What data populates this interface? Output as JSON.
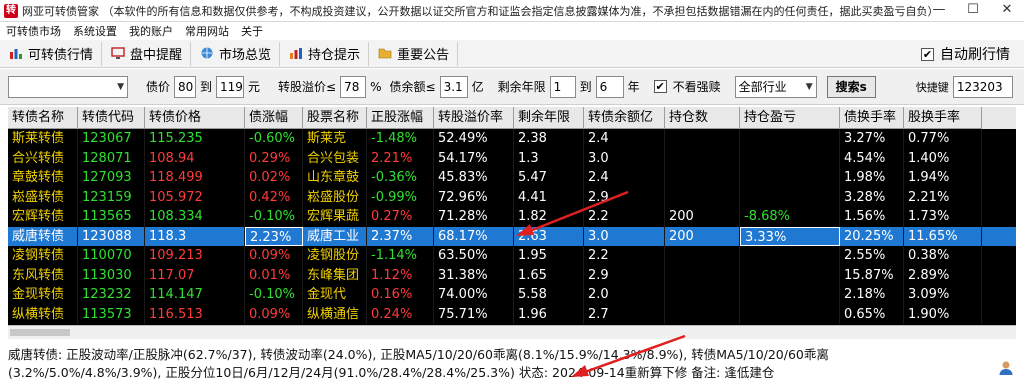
{
  "window": {
    "title": "网亚可转债管家 （本软件的所有信息和数据仅供参考，不构成投资建议，公开数据以证交所官方和证监会指定信息披露媒体为准，不承担包括数据错漏在内的任何责任，据此买卖盈亏自负）",
    "icon_glyph": "转",
    "minimize": "—",
    "maximize": "☐",
    "close": "✕"
  },
  "menu": [
    "可转债市场",
    "系统设置",
    "我的账户",
    "常用网站",
    "关于"
  ],
  "tabs": [
    {
      "label": "可转债行情",
      "icon": "chart-bars-icon"
    },
    {
      "label": "盘中提醒",
      "icon": "monitor-icon"
    },
    {
      "label": "市场总览",
      "icon": "globe-icon"
    },
    {
      "label": "持仓提示",
      "icon": "bar-chart-icon"
    },
    {
      "label": "重要公告",
      "icon": "folder-icon"
    }
  ],
  "auto_refresh": {
    "label": "自动刷行情",
    "checked": true
  },
  "filters": {
    "category_value": "",
    "bond_price_label": "债价",
    "bond_price_min": "80",
    "to1": "到",
    "bond_price_max": "119",
    "yuan": "元",
    "premium_label": "转股溢价≤",
    "premium_value": "78",
    "pct": "%",
    "balance_label": "债余额≤",
    "balance_value": "3.1",
    "yi": "亿",
    "years_label": "剩余年限",
    "years_min": "1",
    "to2": "到",
    "years_max": "6",
    "nian": "年",
    "hide_forced_label": "不看强赎",
    "hide_forced_checked": true,
    "industry_value": "全部行业",
    "search_label": "搜索s",
    "hotkey_label": "快捷键",
    "hotkey_value": "123203"
  },
  "table": {
    "columns": [
      "转债名称",
      "转债代码",
      "转债价格",
      "债涨幅",
      "股票名称",
      "正股涨幅",
      "转股溢价率",
      "剩余年限",
      "转债余额亿",
      "持仓数",
      "持仓盈亏",
      "债换手率",
      "股换手率"
    ],
    "rows": [
      [
        "斯莱转债",
        "123067",
        "115.235",
        "-0.60%",
        "斯莱克",
        "-1.48%",
        "52.49%",
        "2.38",
        "2.4",
        "",
        "",
        "3.27%",
        "0.77%"
      ],
      [
        "合兴转债",
        "128071",
        "108.94",
        "0.29%",
        "合兴包装",
        "2.21%",
        "54.17%",
        "1.3",
        "3.0",
        "",
        "",
        "4.54%",
        "1.40%"
      ],
      [
        "章鼓转债",
        "127093",
        "118.499",
        "0.02%",
        "山东章鼓",
        "-0.36%",
        "45.83%",
        "5.47",
        "2.4",
        "",
        "",
        "1.98%",
        "1.94%"
      ],
      [
        "崧盛转债",
        "123159",
        "105.972",
        "0.42%",
        "崧盛股份",
        "-0.99%",
        "72.96%",
        "4.41",
        "2.9",
        "",
        "",
        "3.28%",
        "2.21%"
      ],
      [
        "宏辉转债",
        "113565",
        "108.334",
        "-0.10%",
        "宏辉果蔬",
        "0.27%",
        "71.28%",
        "1.82",
        "2.2",
        "200",
        "-8.68%",
        "1.56%",
        "1.73%"
      ],
      [
        "威唐转债",
        "123088",
        "118.3",
        "2.23%",
        "威唐工业",
        "2.37%",
        "68.17%",
        "2.63",
        "3.0",
        "200",
        "3.33%",
        "20.25%",
        "11.65%"
      ],
      [
        "凌钢转债",
        "110070",
        "109.213",
        "0.09%",
        "凌钢股份",
        "-1.14%",
        "63.50%",
        "1.95",
        "2.2",
        "",
        "",
        "2.55%",
        "0.38%"
      ],
      [
        "东风转债",
        "113030",
        "117.07",
        "0.01%",
        "东峰集团",
        "1.12%",
        "31.38%",
        "1.65",
        "2.9",
        "",
        "",
        "15.87%",
        "2.89%"
      ],
      [
        "金现转债",
        "123232",
        "114.147",
        "-0.10%",
        "金现代",
        "0.16%",
        "74.00%",
        "5.58",
        "2.0",
        "",
        "",
        "2.18%",
        "3.09%"
      ],
      [
        "纵横转债",
        "113573",
        "116.513",
        "0.09%",
        "纵横通信",
        "0.24%",
        "75.71%",
        "1.96",
        "2.7",
        "",
        "",
        "0.65%",
        "1.90%"
      ]
    ],
    "selected_row": 5
  },
  "status": {
    "line1": "威唐转债: 正股波动率/正股脉冲(62.7%/37), 转债波动率(24.0%), 正股MA5/10/20/60乖离(8.1%/15.9%/14.3%/8.9%), 转债MA5/10/20/60乖离",
    "line2": "(3.2%/5.0%/4.8%/3.9%), 正股分位10日/6月/12月/24月(91.0%/28.4%/28.4%/25.3%) 状态: 2024-09-14重新算下修 备注: 逢低建仓"
  },
  "colors": {
    "name": "#f0d000",
    "code": "#30e030",
    "up": "#ff3b3b",
    "down": "#30e030",
    "neutral": "#ffffff",
    "selected_bg": "#1f78d1",
    "arrow": "#e02020"
  }
}
